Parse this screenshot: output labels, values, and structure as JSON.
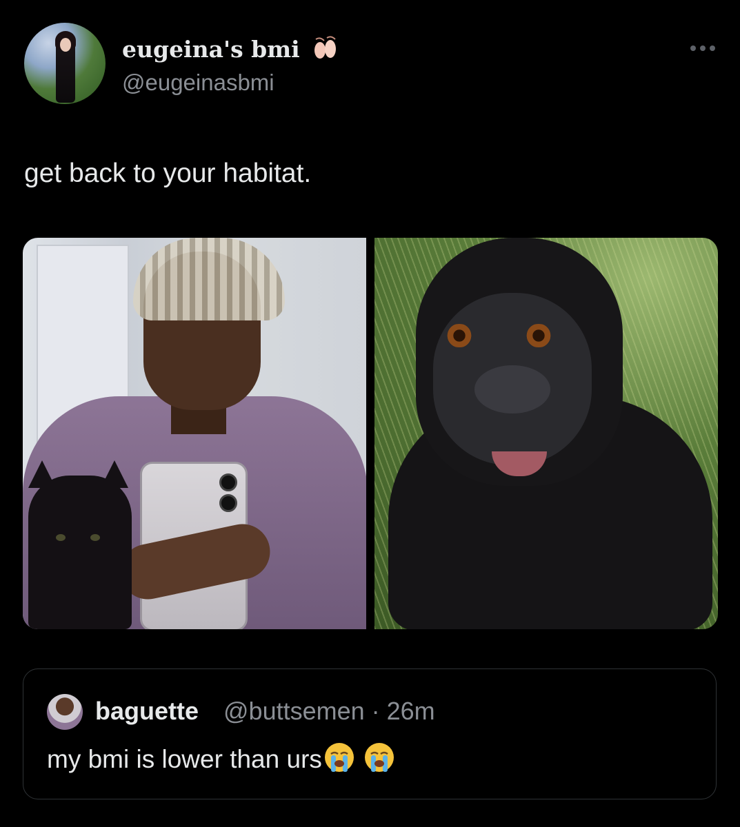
{
  "tweet": {
    "display_name": "eugeina's bmi",
    "name_icon": "ballet-shoes-icon",
    "handle": "@eugeinasbmi",
    "text": "get back to your habitat.",
    "more_icon": "more-options-icon"
  },
  "media": {
    "left_image": "person-selfie-with-cat-photo",
    "right_image": "baby-gorilla-photo"
  },
  "quoted_tweet": {
    "display_name": "baguette",
    "handle_time": "@buttsemen · 26m",
    "text": "my bmi is lower than urs",
    "emoji": [
      "loudly-crying-face-icon",
      "loudly-crying-face-icon"
    ]
  },
  "colors": {
    "background": "#000000",
    "text_primary": "#e7e9ea",
    "text_secondary": "#8b8f95",
    "border": "#2f3336"
  }
}
